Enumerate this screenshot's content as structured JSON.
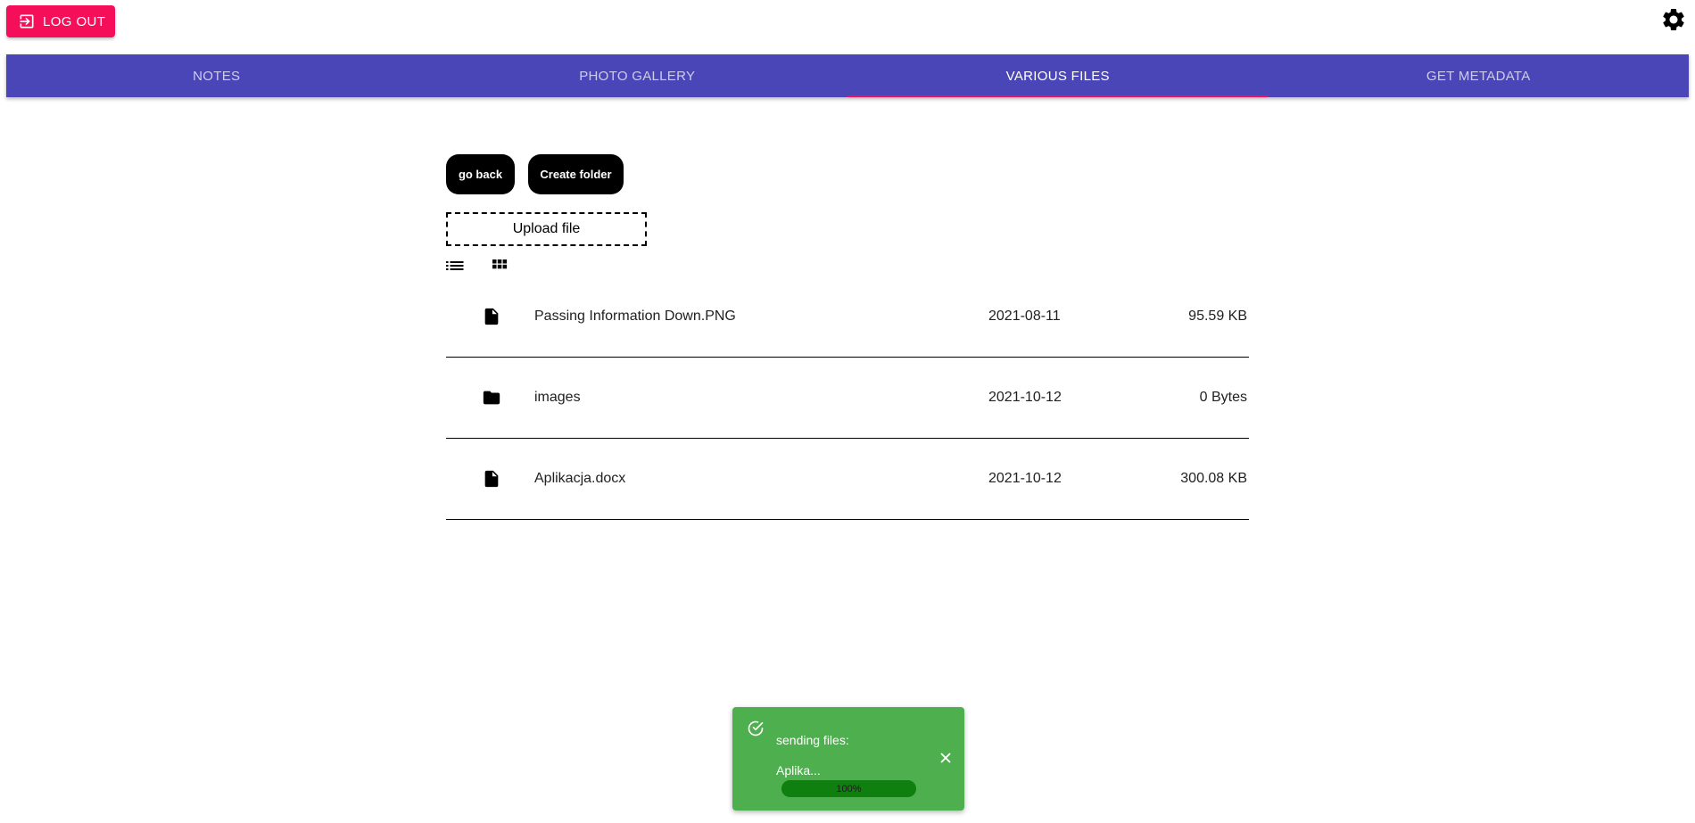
{
  "header": {
    "logout_label": "LOG OUT",
    "logout_icon": "logout-icon",
    "settings_icon": "gear-icon"
  },
  "tabs": [
    {
      "label": "NOTES",
      "active": false
    },
    {
      "label": "PHOTO GALLERY",
      "active": false
    },
    {
      "label": "VARIOUS FILES",
      "active": true
    },
    {
      "label": "GET METADATA",
      "active": false
    }
  ],
  "actions": {
    "go_back_label": "go back",
    "create_folder_label": "Create folder",
    "upload_label": "Upload file"
  },
  "view_toggle": {
    "list_icon": "list-view-icon",
    "grid_icon": "grid-view-icon"
  },
  "files": [
    {
      "type": "file",
      "icon": "file-icon",
      "name": "Passing Information Down.PNG",
      "date": "2021-08-11",
      "size": "95.59 KB"
    },
    {
      "type": "folder",
      "icon": "folder-icon",
      "name": "images",
      "date": "2021-10-12",
      "size": "0 Bytes"
    },
    {
      "type": "file",
      "icon": "file-icon",
      "name": "Aplikacja.docx",
      "date": "2021-10-12",
      "size": "300.08 KB"
    }
  ],
  "toast": {
    "title": "sending files:",
    "file": "Aplika...",
    "progress_label": "100%",
    "progress": 1.0,
    "check_icon": "check-circle-icon",
    "close_icon": "close-icon"
  },
  "colors": {
    "accent": "#f50f5a",
    "tab_bar": "#4a46b7",
    "toast": "#4eaf4e",
    "progress": "#0f7f0f"
  }
}
